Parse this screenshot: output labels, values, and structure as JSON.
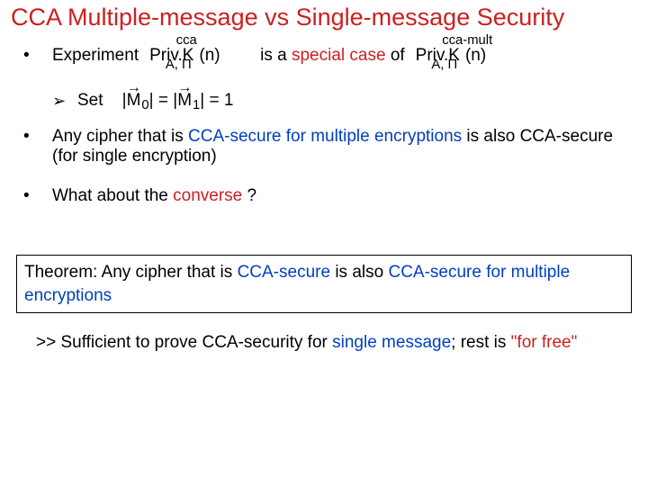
{
  "title": "CCA Multiple-message vs Single-message Security",
  "bullet1": {
    "lead": "Experiment",
    "priv1": {
      "main": "Priv.K",
      "sup": "cca",
      "sub": "A, Π",
      "arg": "(n)"
    },
    "mid": "is a",
    "mid_red": "special case",
    "mid2": "of",
    "priv2": {
      "main": "Priv.K",
      "sup": "cca-mult",
      "sub": "A, Π",
      "arg": "(n)"
    }
  },
  "sub1": {
    "set": "Set",
    "m0": "M",
    "s0": "0",
    "m1": "M",
    "s1": "1",
    "bar": "|",
    "eq": " = ",
    "tail": " = 1",
    "arrow": "→"
  },
  "bullet2": {
    "pre": "Any cipher that is ",
    "blue": "CCA-secure for multiple encryptions",
    "post": " is also CCA-secure (for single encryption)"
  },
  "bullet3": {
    "pre": "What about the ",
    "red": "converse",
    "post": " ?"
  },
  "theorem": {
    "pre": "Theorem: Any cipher that is ",
    "blue1": "CCA-secure",
    "mid": " is also ",
    "blue2": "CCA-secure for multiple encryptions"
  },
  "foot": {
    "pre": " >> Sufficient to prove CCA-security for ",
    "blue": "single message",
    "mid": "; rest is ",
    "red": "\"for free\""
  },
  "markers": {
    "dot": "•",
    "arrowhead": "➢"
  }
}
